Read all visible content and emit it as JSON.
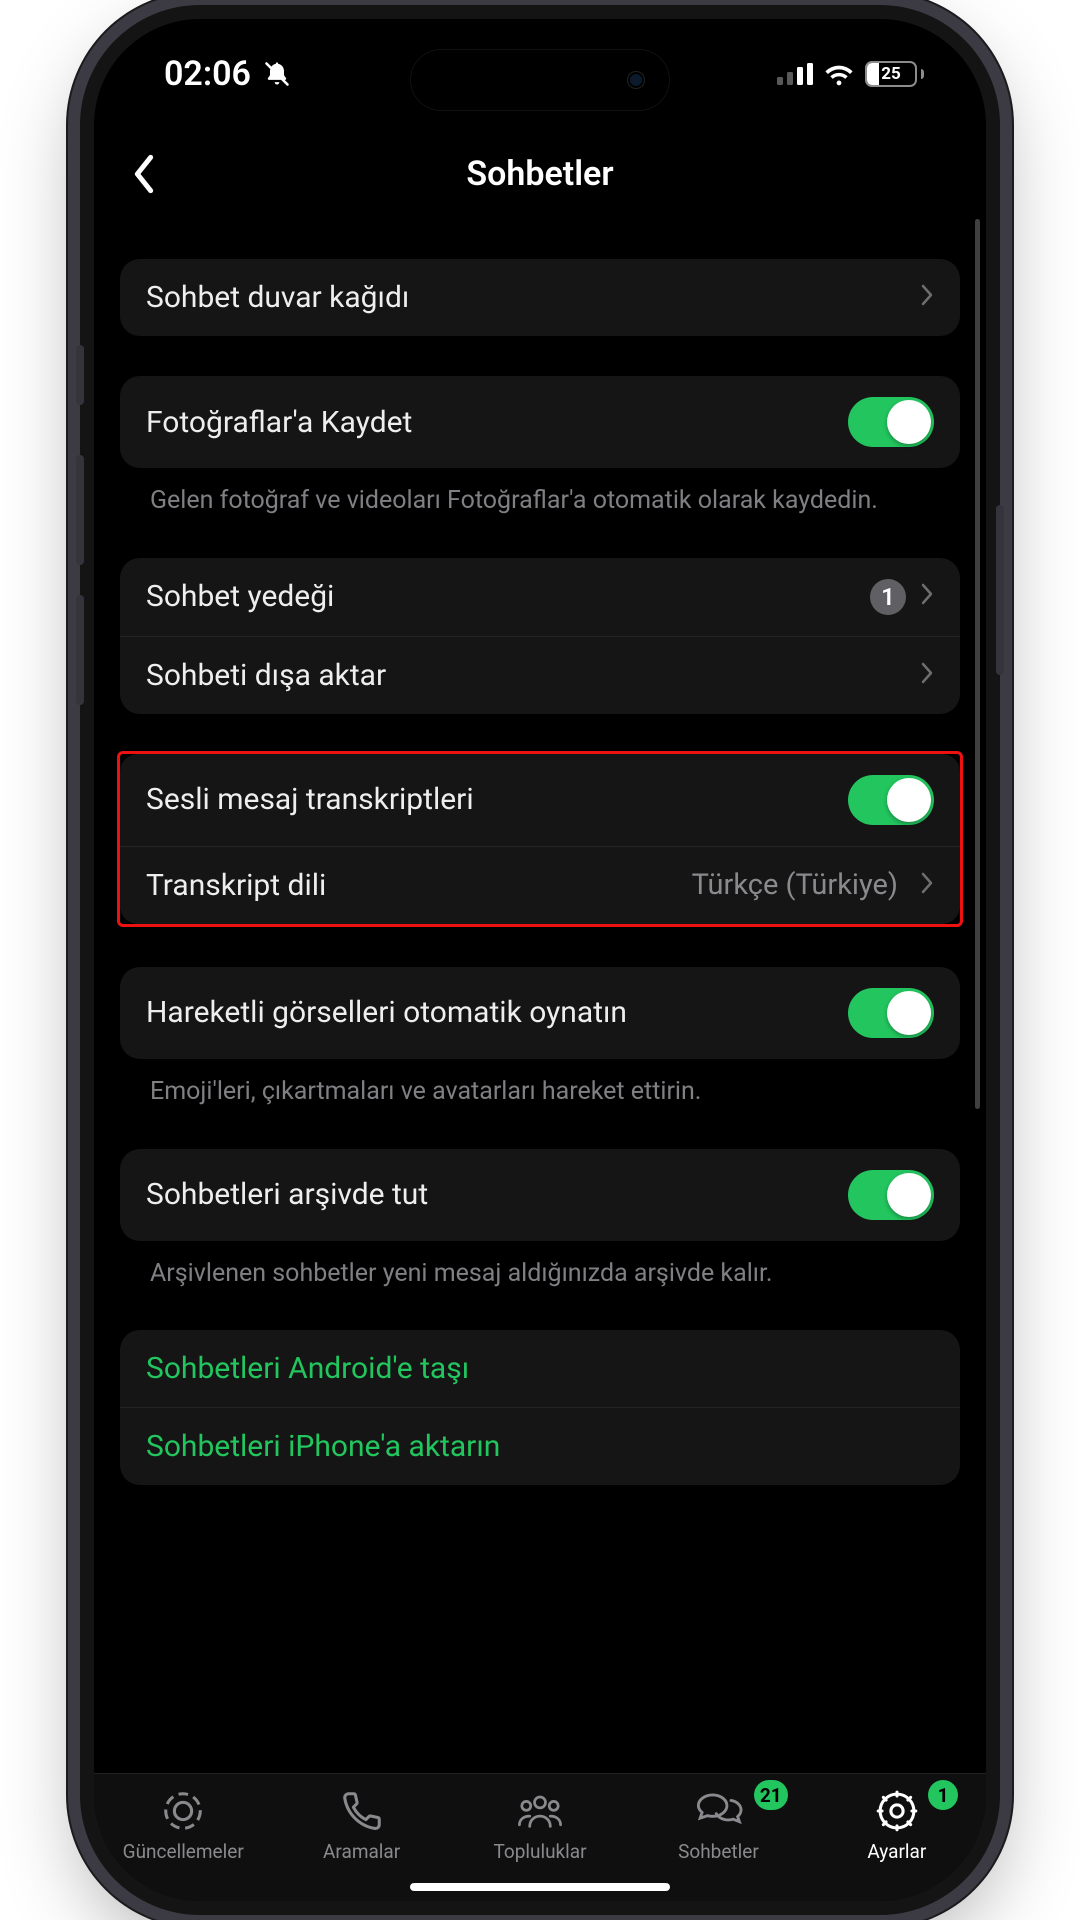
{
  "status": {
    "time": "02:06",
    "battery": "25"
  },
  "header": {
    "title": "Sohbetler"
  },
  "rows": {
    "wallpaper": "Sohbet duvar kağıdı",
    "save_photos": "Fotoğraflar'a Kaydet",
    "save_photos_desc": "Gelen fotoğraf ve videoları Fotoğraflar'a otomatik olarak kaydedin.",
    "backup": "Sohbet yedeği",
    "backup_badge": "1",
    "export": "Sohbeti dışa aktar",
    "transcripts": "Sesli mesaj transkriptleri",
    "transcript_lang_label": "Transkript dili",
    "transcript_lang_value": "Türkçe (Türkiye)",
    "autoplay": "Hareketli görselleri otomatik oynatın",
    "autoplay_desc": "Emoji'leri, çıkartmaları ve avatarları hareket ettirin.",
    "archive": "Sohbetleri arşivde tut",
    "archive_desc": "Arşivlenen sohbetler yeni mesaj aldığınızda arşivde kalır.",
    "move_android": "Sohbetleri Android'e taşı",
    "move_iphone": "Sohbetleri iPhone'a aktarın"
  },
  "tabs": {
    "updates": "Güncellemeler",
    "calls": "Aramalar",
    "communities": "Topluluklar",
    "chats": "Sohbetler",
    "chats_badge": "21",
    "settings": "Ayarlar",
    "settings_badge": "1"
  }
}
